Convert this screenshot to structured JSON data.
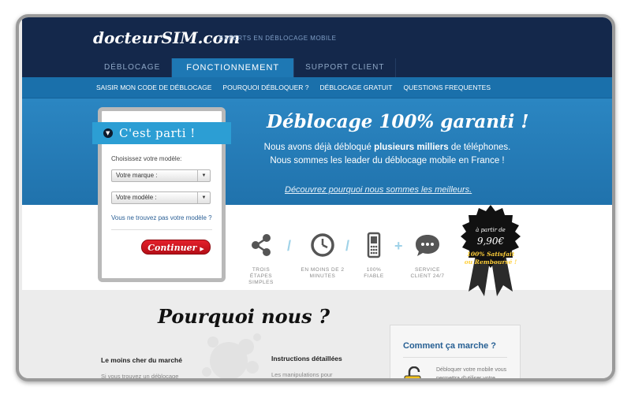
{
  "header": {
    "logo": "docteurSIM.com",
    "tagline": "EXPERTS EN DÉBLOCAGE MOBILE",
    "tabs": [
      {
        "label": "DÉBLOCAGE",
        "active": false
      },
      {
        "label": "FONCTIONNEMENT",
        "active": true
      },
      {
        "label": "SUPPORT CLIENT",
        "active": false
      }
    ]
  },
  "subnav": {
    "items": [
      "SAISIR MON CODE DE DÉBLOCAGE",
      "POURQUOI DÉBLOQUER ?",
      "DÉBLOCAGE GRATUIT",
      "QUESTIONS FREQUENTES"
    ]
  },
  "hero": {
    "title": "Déblocage 100% garanti !",
    "line1_pre": "Nous avons déjà débloqué ",
    "line1_bold": "plusieurs milliers",
    "line1_post": " de téléphones.",
    "line2": "Nous sommes les leader du déblocage mobile en France !",
    "link": "Découvrez pourquoi nous sommes les meilleurs."
  },
  "form": {
    "ribbon": "C'est parti !",
    "label": "Choisissez votre modèle:",
    "brand_select": "Votre marque :",
    "model_select": "Votre modèle :",
    "help_link": "Vous ne trouvez pas votre modèle ?",
    "continue_label": "Continuer"
  },
  "features": [
    {
      "icon": "share-icon",
      "text_lines": [
        "TROIS",
        "ÉTAPES",
        "SIMPLES"
      ]
    },
    {
      "icon": "clock-icon",
      "text_lines": [
        "EN MOINS DE 2",
        "MINUTES"
      ]
    },
    {
      "icon": "phone-icon",
      "text_lines": [
        "100%",
        "FIABLE"
      ]
    },
    {
      "icon": "chat-icon",
      "text_lines": [
        "SERVICE",
        "CLIENT 24/7"
      ]
    }
  ],
  "badge": {
    "small": "à partir de",
    "price": "9,90€",
    "promise_line1": "100% Satisfait",
    "promise_line2": "ou Remboursé !"
  },
  "bottom": {
    "title": "Pourquoi nous ?",
    "col1_title": "Le moins cher du marché",
    "col1_text": "Si vous trouvez un déblocage",
    "col2_title": "Instructions détaillées",
    "col2_text": "Les manipulations pour",
    "side_title": "Comment ça marche ?",
    "side_text": "Débloquer votre mobile vous permettra d'utiliser votre téléphone avec"
  },
  "colors": {
    "header_bg": "#14284b",
    "tab_active": "#1e78b4",
    "hero_bg": "#2b86c2",
    "ribbon": "#2c9ed4",
    "button_red": "#e4202b",
    "badge_black": "#111111"
  }
}
